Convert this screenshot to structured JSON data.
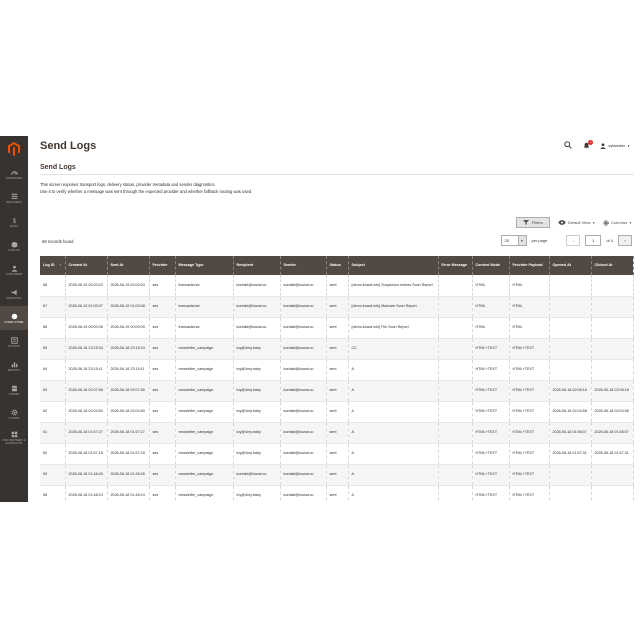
{
  "sidebar": {
    "items": [
      {
        "label": "Dashboard",
        "icon": "dashboard-icon"
      },
      {
        "label": "Mega Menu",
        "icon": "mega-menu-icon"
      },
      {
        "label": "Sales",
        "icon": "dollar-icon"
      },
      {
        "label": "Catalog",
        "icon": "box-icon"
      },
      {
        "label": "Customers",
        "icon": "person-icon"
      },
      {
        "label": "Marketing",
        "icon": "megaphone-icon"
      },
      {
        "label": "Kowal Store",
        "icon": "store-icon"
      },
      {
        "label": "Content",
        "icon": "content-icon"
      },
      {
        "label": "Reports",
        "icon": "bar-chart-icon"
      },
      {
        "label": "Stores",
        "icon": "stores-icon"
      },
      {
        "label": "System",
        "icon": "gear-icon"
      },
      {
        "label": "Find Partners & Extensions",
        "icon": "extensions-icon"
      }
    ],
    "active_index": 6
  },
  "header": {
    "page_title": "Send Logs",
    "notification_count": "1",
    "user_name": "sylwester"
  },
  "section": {
    "title": "Send Logs",
    "description_line1": "This screen exposes transport logs, delivery status, provider metadata and sender diagnostics.",
    "description_line2": "Use it to verify whether a message was sent through the expected provider and whether fallback routing was used."
  },
  "toolbar": {
    "filters_label": "Filters",
    "view_label": "Default View",
    "columns_label": "Columns"
  },
  "grid_info": {
    "records_found": "68 records found",
    "per_page_value": "20",
    "per_page_label": "per page",
    "current_page": "1",
    "of_pages": "of 4"
  },
  "table": {
    "columns": [
      "Log ID",
      "Created At",
      "Sent At",
      "Provider",
      "Message Type",
      "Recipient",
      "Sender",
      "Status",
      "Subject",
      "Error Message",
      "Content Mode",
      "Provider Payload",
      "Opened At",
      "Clicked At"
    ],
    "rows": [
      [
        "68",
        "2026-06-19 02:00:03",
        "2026-06-19 02:00:04",
        "ses",
        "transactional",
        "kontakt@kowal.co",
        "kontakt@kowal.co",
        "sent",
        "[demo.kowal.info] Suspicious entries Scan Report",
        "",
        "HTML",
        "HTML",
        "",
        ""
      ],
      [
        "67",
        "2026-06-19 01:00:07",
        "2026-06-19 01:00:08",
        "ses",
        "transactional",
        "kontakt@kowal.co",
        "kontakt@kowal.co",
        "sent",
        "[demo.kowal.info] Malware Scan Report",
        "",
        "HTML",
        "HTML",
        "",
        ""
      ],
      [
        "66",
        "2026-06-19 00:00:08",
        "2026-06-19 00:00:09",
        "ses",
        "transactional",
        "kontakt@kowal.co",
        "kontakt@kowal.co",
        "sent",
        "[demo.kowal.info] File Scan Report",
        "",
        "HTML",
        "HTML",
        "",
        ""
      ],
      [
        "65",
        "2026-06-18 23:15:34",
        "2026-06-18 23:15:34",
        "ses",
        "newsletter_campaign",
        "toy@4my.baby",
        "kontakt@kowal.co",
        "sent",
        "CC",
        "",
        "HTML+TEXT",
        "HTML+TEXT",
        "",
        ""
      ],
      [
        "64",
        "2026-06-18 23:15:11",
        "2026-06-18 23:15:11",
        "ses",
        "newsletter_campaign",
        "toy@4my.baby",
        "kontakt@kowal.co",
        "sent",
        "A",
        "",
        "HTML+TEXT",
        "HTML+TEXT",
        "",
        ""
      ],
      [
        "63",
        "2026-06-18 02:07:56",
        "2026-06-18 02:07:56",
        "ses",
        "newsletter_campaign",
        "toy@4my.baby",
        "kontakt@kowal.co",
        "sent",
        "A",
        "",
        "HTML+TEXT",
        "HTML+TEXT",
        "2026-06-18 02:08:18",
        "2026-06-18 02:08:18"
      ],
      [
        "62",
        "2026-06-18 02:04:50",
        "2026-06-18 02:04:50",
        "ses",
        "newsletter_campaign",
        "toy@4my.baby",
        "kontakt@kowal.co",
        "sent",
        "A",
        "",
        "HTML+TEXT",
        "HTML+TEXT",
        "2026-06-18 02:04:58",
        "2026-06-18 02:04:58"
      ],
      [
        "61",
        "2026-06-18 01:57:27",
        "2026-06-18 01:57:27",
        "ses",
        "newsletter_campaign",
        "toy@4my.baby",
        "kontakt@kowal.co",
        "sent",
        "A",
        "",
        "HTML+TEXT",
        "HTML+TEXT",
        "2026-06-18 01:58:07",
        "2026-06-18 01:58:07"
      ],
      [
        "60",
        "2026-06-18 01:57:18",
        "2026-06-18 01:57:18",
        "ses",
        "newsletter_campaign",
        "toy@4my.baby",
        "kontakt@kowal.co",
        "sent",
        "A",
        "",
        "HTML+TEXT",
        "HTML+TEXT",
        "2026-06-18 01:57:31",
        "2026-06-18 01:57:31"
      ],
      [
        "59",
        "2026-06-18 01:48:45",
        "2026-06-18 01:48:45",
        "ses",
        "newsletter_campaign",
        "kontakt@kowal.co",
        "kontakt@kowal.co",
        "sent",
        "A",
        "",
        "HTML+TEXT",
        "HTML+TEXT",
        "",
        ""
      ],
      [
        "58",
        "2026-06-18 01:48:24",
        "2026-06-18 01:48:24",
        "ses",
        "newsletter_campaign",
        "toy@4my.baby",
        "kontakt@kowal.co",
        "sent",
        "A",
        "",
        "HTML+TEXT",
        "HTML+TEXT",
        "",
        ""
      ]
    ]
  },
  "colors": {
    "sidebar_bg": "#373330",
    "sidebar_active": "#514943",
    "brand_orange": "#eb5202",
    "table_header": "#514943",
    "badge_red": "#e22626"
  }
}
